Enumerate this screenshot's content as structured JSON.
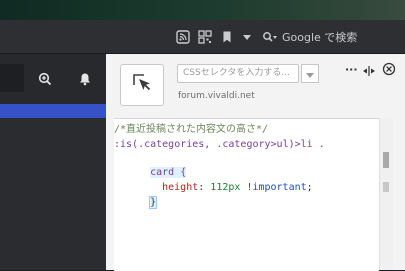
{
  "toolbar": {
    "search_placeholder": "Google で検索"
  },
  "devtools": {
    "selector_placeholder": "CSSセレクタを入力する...",
    "host": "forum.vivaldi.net",
    "more_label": "···",
    "resize_label": "<|>",
    "close_label": "⊗"
  },
  "code": {
    "line1": "/*直近投稿された内容文の高さ*/",
    "line2_a": ":is(.categories, .category>ul)>li .",
    "line3_a": "card {",
    "line4_prop": "height",
    "line4_val": "112px",
    "line4_imp": "!important",
    "line5": "}"
  },
  "colors": {
    "comment": "#6a8759",
    "selector": "#7a3e9d",
    "property": "#b22222",
    "value": "#1a7f37",
    "important": "#1f4fb8",
    "accent_blue": "#3552c9"
  }
}
